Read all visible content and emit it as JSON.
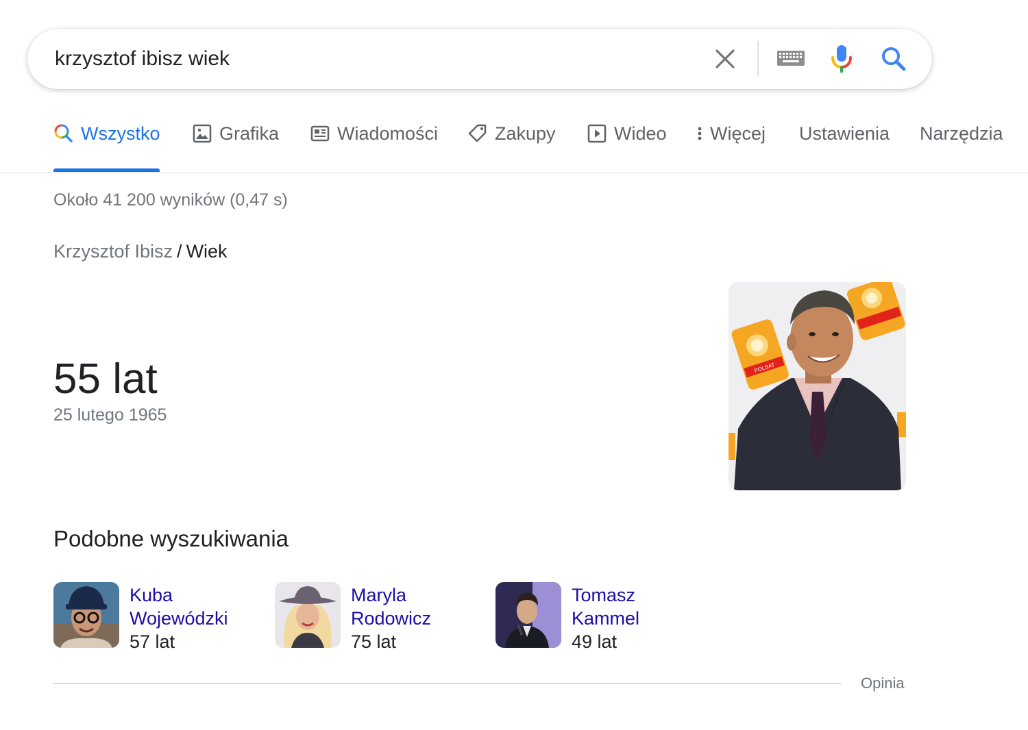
{
  "search": {
    "query": "krzysztof ibisz wiek",
    "clear_icon": "close-icon",
    "keyboard_icon": "keyboard-icon",
    "mic_icon": "mic-icon",
    "search_icon": "search-icon"
  },
  "tabs": [
    {
      "label": "Wszystko",
      "icon": "search-icon",
      "active": true
    },
    {
      "label": "Grafika",
      "icon": "image-icon"
    },
    {
      "label": "Wiadomości",
      "icon": "news-icon"
    },
    {
      "label": "Zakupy",
      "icon": "tag-icon"
    },
    {
      "label": "Wideo",
      "icon": "play-icon"
    },
    {
      "label": "Więcej",
      "icon": "more-vert-icon"
    },
    {
      "label": "Ustawienia"
    },
    {
      "label": "Narzędzia"
    }
  ],
  "result_stats": "Około 41 200 wyników (0,47 s)",
  "breadcrumb": {
    "parent": "Krzysztof Ibisz",
    "separator": "/",
    "current": "Wiek"
  },
  "answer": {
    "value": "55 lat",
    "date": "25 lutego 1965"
  },
  "photo": {
    "description": "portrait",
    "logo_text": "POLSAT"
  },
  "related": {
    "title": "Podobne wyszukiwania",
    "items": [
      {
        "name_line1": "Kuba",
        "name_line2": "Wojewódzki",
        "age": "57 lat"
      },
      {
        "name_line1": "Maryla",
        "name_line2": "Rodowicz",
        "age": "75 lat"
      },
      {
        "name_line1": "Tomasz",
        "name_line2": "Kammel",
        "age": "49 lat"
      }
    ]
  },
  "feedback": "Opinia",
  "colors": {
    "accent": "#1a73e8",
    "link": "#1a0dab",
    "muted": "#70757a",
    "text": "#202124"
  }
}
